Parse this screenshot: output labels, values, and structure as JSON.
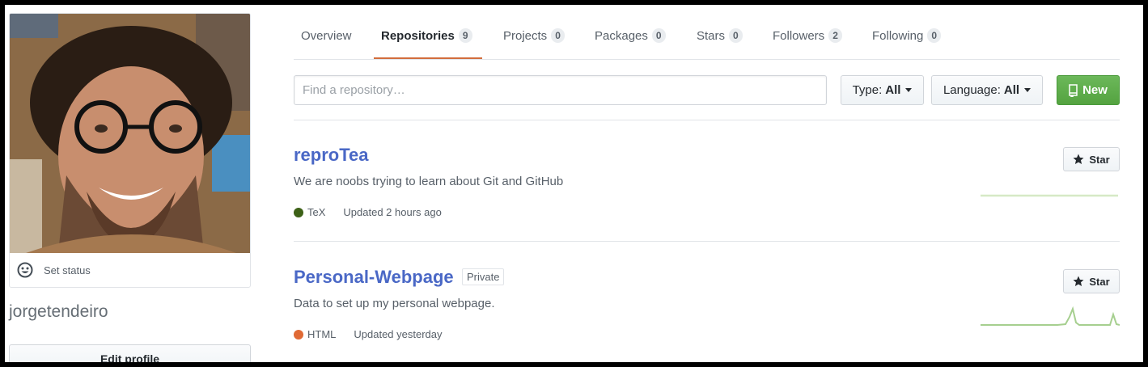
{
  "profile": {
    "set_status_label": "Set status",
    "username": "jorgetendeiro",
    "edit_profile_label": "Edit profile"
  },
  "tabs": [
    {
      "label": "Overview",
      "count": null,
      "active": false
    },
    {
      "label": "Repositories",
      "count": "9",
      "active": true
    },
    {
      "label": "Projects",
      "count": "0",
      "active": false
    },
    {
      "label": "Packages",
      "count": "0",
      "active": false
    },
    {
      "label": "Stars",
      "count": "0",
      "active": false
    },
    {
      "label": "Followers",
      "count": "2",
      "active": false
    },
    {
      "label": "Following",
      "count": "0",
      "active": false
    }
  ],
  "filters": {
    "search_placeholder": "Find a repository…",
    "type_label": "Type:",
    "type_value": "All",
    "language_label": "Language:",
    "language_value": "All",
    "new_label": "New"
  },
  "repos": [
    {
      "name": "reproTea",
      "private_badge": null,
      "description": "We are noobs trying to learn about Git and GitHub",
      "language": "TeX",
      "language_color": "#3D6117",
      "updated": "Updated 2 hours ago",
      "star_label": "Star"
    },
    {
      "name": "Personal-Webpage",
      "private_badge": "Private",
      "description": "Data to set up my personal webpage.",
      "language": "HTML",
      "language_color": "#e34c26",
      "updated": "Updated yesterday",
      "star_label": "Star"
    }
  ],
  "colors": {
    "link": "#4a68c6",
    "tab_active_underline": "#d26d3c",
    "new_button": "#5cae4a"
  }
}
